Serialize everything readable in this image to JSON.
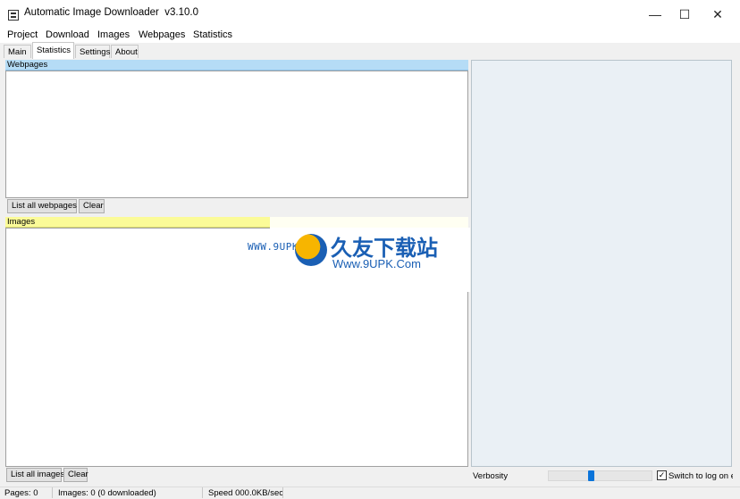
{
  "window": {
    "title": "Automatic Image Downloader  v3.10.0",
    "minimize": "—",
    "maximize": "☐",
    "close": "✕"
  },
  "menu": [
    "Project",
    "Download",
    "Images",
    "Webpages",
    "Statistics"
  ],
  "tabs": [
    "Main",
    "Statistics",
    "Settings",
    "About"
  ],
  "active_tab": "Statistics",
  "webpages": {
    "header": "Webpages",
    "list_button": "List all webpages",
    "clear_button": "Clear"
  },
  "images": {
    "header": "Images",
    "list_button": "List all images",
    "clear_button": "Clear"
  },
  "verbosity": {
    "label": "Verbosity",
    "level": 0.41
  },
  "log_toggle": {
    "label": "Switch to log on e",
    "checked": true,
    "mark": "✓"
  },
  "status": {
    "pages": "Pages: 0",
    "images": "Images: 0 (0 downloaded)",
    "speed": "Speed 000.0KB/sec"
  },
  "watermark": {
    "small": "WWW.9UPK.COM",
    "cn": "久友下载站",
    "url": "Www.9UPK.Com"
  },
  "icons": {
    "app": "app-icon",
    "check": "checkmark-icon"
  }
}
